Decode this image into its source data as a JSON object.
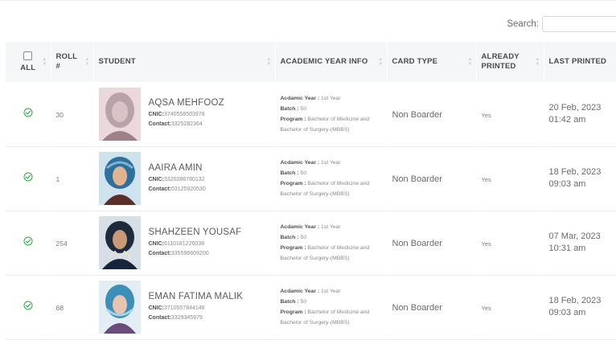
{
  "search": {
    "label": "Search:",
    "value": "",
    "placeholder": ""
  },
  "headers": {
    "all": "ALL",
    "roll_line1": "ROLL",
    "roll_line2": "#",
    "student": "STUDENT",
    "academic": "ACADEMIC YEAR INFO",
    "card_type": "CARD TYPE",
    "already_line1": "ALREADY",
    "already_line2": "PRINTED",
    "last_printed": "LAST PRINTED"
  },
  "labels": {
    "cnic": "CNIC:",
    "contact": "Contact:",
    "academic_year": "Acdamic Year :",
    "batch": "Batch :",
    "program": "Program :"
  },
  "rows": [
    {
      "roll": "30",
      "name": "AQSA MEHFOOZ",
      "cnic": "3740558503978",
      "contact": "3325282364",
      "academic_year": "1st Year",
      "batch": "50",
      "program_line1": "Bachelor of Medicine and",
      "program_line2": "Bachelor of Surgery-(MBBS)",
      "card_type": "Non Boarder",
      "already_printed": "Yes",
      "last_date": "20 Feb, 2023",
      "last_time": "01:42 am"
    },
    {
      "roll": "1",
      "name": "AAIRA AMIN",
      "cnic": "3320286780132",
      "contact": "03125920530",
      "academic_year": "1st Year",
      "batch": "50",
      "program_line1": "Bachelor of Medicine and",
      "program_line2": "Bachelor of Surgery-(MBBS)",
      "card_type": "Non Boarder",
      "already_printed": "Yes",
      "last_date": "18 Feb, 2023",
      "last_time": "09:03 am"
    },
    {
      "roll": "254",
      "name": "SHAHZEEN YOUSAF",
      "cnic": "6110181226038",
      "contact": "335596609200",
      "academic_year": "1st Year",
      "batch": "50",
      "program_line1": "Bachelor of Medicine and",
      "program_line2": "Bachelor of Surgery-(MBBS)",
      "card_type": "Non Boarder",
      "already_printed": "Yes",
      "last_date": "07 Mar, 2023",
      "last_time": "10:31 am"
    },
    {
      "roll": "68",
      "name": "EMAN FATIMA MALIK",
      "cnic": "3710557844146",
      "contact": "3329345979",
      "academic_year": "1st Year",
      "batch": "50",
      "program_line1": "Bachelor of Medicine and",
      "program_line2": "Bachelor of Surgery-(MBBS)",
      "card_type": "Non Boarder",
      "already_printed": "Yes",
      "last_date": "18 Feb, 2023",
      "last_time": "09:03 am"
    }
  ],
  "colors": {
    "check": "#28a745",
    "header_bg": "#f5f6f7"
  },
  "icons": {
    "row_check": "check-circle-icon",
    "select_all": "checkbox-icon",
    "sort": "sort-icon"
  }
}
